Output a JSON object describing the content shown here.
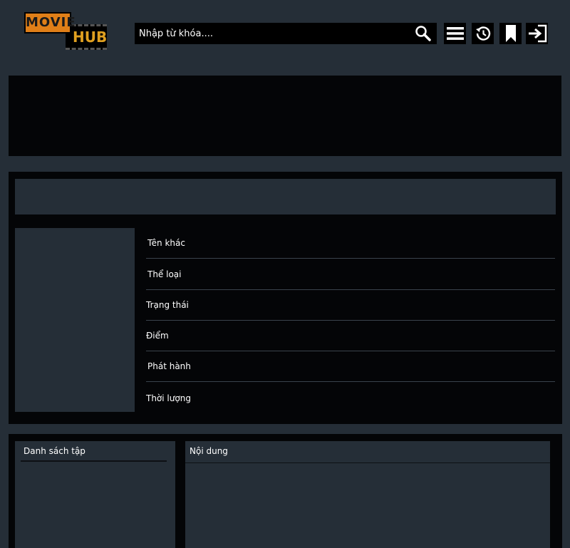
{
  "header": {
    "logo": {
      "word1": "MOVIE",
      "word2": "HUB"
    },
    "search": {
      "placeholder": "Nhập từ khóa...."
    },
    "icons": [
      "search-icon",
      "menu-icon",
      "history-icon",
      "bookmark-icon",
      "login-icon"
    ]
  },
  "info": {
    "rows": [
      {
        "label": "Tên khác"
      },
      {
        "label": "Thể loại"
      },
      {
        "label": "Trạng thái"
      },
      {
        "label": "Điểm"
      },
      {
        "label": "Phát hành"
      },
      {
        "label": "Thời lượng"
      }
    ]
  },
  "episodes": {
    "title": "Danh sách tập"
  },
  "content": {
    "title": "Nội dung"
  },
  "colors": {
    "background": "#252e37",
    "panel": "#040507",
    "logo_orange": "#e07f18",
    "logo_gold": "#e0a020"
  }
}
